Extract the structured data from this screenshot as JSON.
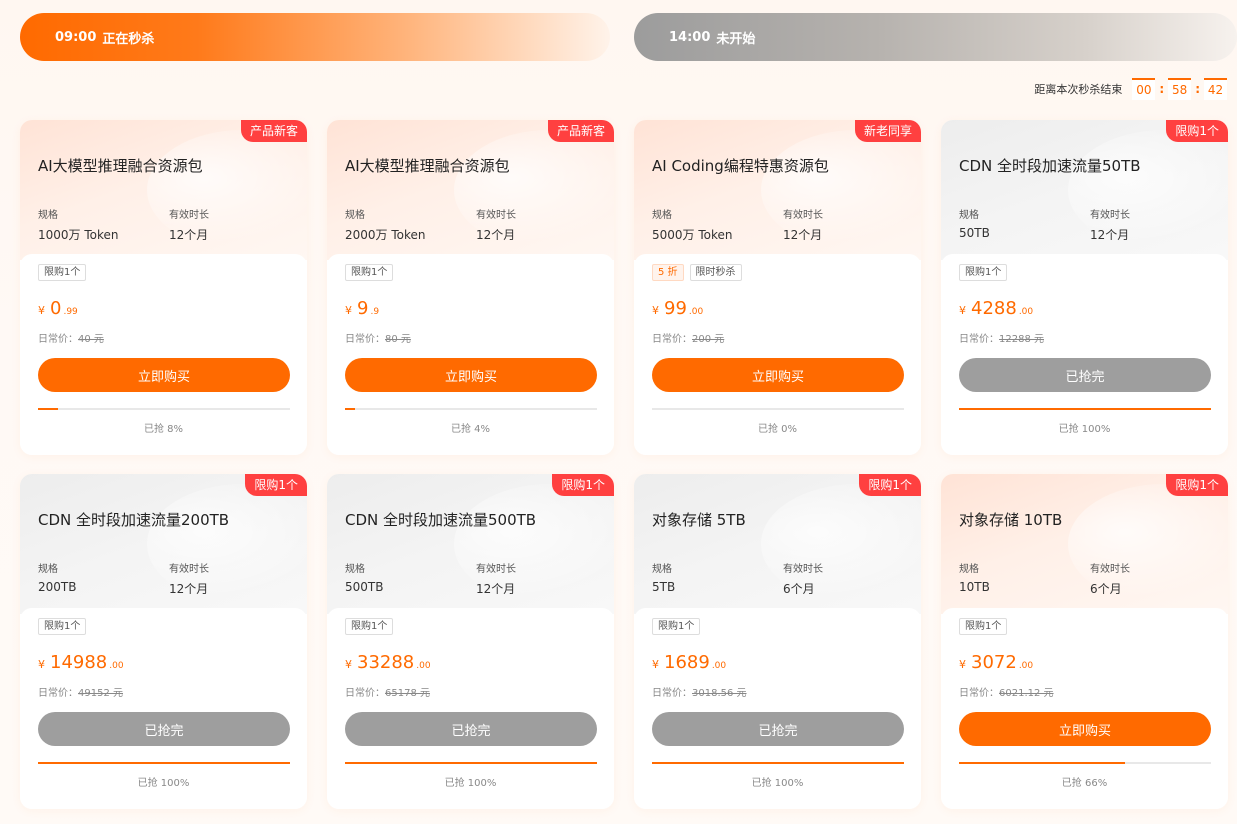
{
  "sessions": [
    {
      "time": "09:00",
      "status": "正在秒杀"
    },
    {
      "time": "14:00",
      "status": "未开始"
    }
  ],
  "countdown": {
    "label": "距离本次秒杀结束",
    "hours": "00",
    "minutes": "58",
    "seconds": "42"
  },
  "spec_label": "规格",
  "duration_label": "有效时长",
  "orig_label": "日常价：",
  "products": [
    {
      "badge": "产品新客",
      "badge_theme": "warm",
      "title": "AI大模型推理融合资源包",
      "spec": "1000万 Token",
      "duration": "12个月",
      "tags": [
        {
          "text": "限购1个",
          "type": "normal"
        }
      ],
      "price_int": "0",
      "price_dec": ".99",
      "orig_price": "40 元",
      "button": "立即购买",
      "button_state": "buy",
      "progress_pct": 8,
      "progress_text": "已抢 8%"
    },
    {
      "badge": "产品新客",
      "badge_theme": "warm",
      "title": "AI大模型推理融合资源包",
      "spec": "2000万 Token",
      "duration": "12个月",
      "tags": [
        {
          "text": "限购1个",
          "type": "normal"
        }
      ],
      "price_int": "9",
      "price_dec": ".9",
      "orig_price": "80 元",
      "button": "立即购买",
      "button_state": "buy",
      "progress_pct": 4,
      "progress_text": "已抢 4%"
    },
    {
      "badge": "新老同享",
      "badge_theme": "warm",
      "title": "AI Coding编程特惠资源包",
      "spec": "5000万 Token",
      "duration": "12个月",
      "tags": [
        {
          "text": "5 折",
          "type": "disc"
        },
        {
          "text": "限时秒杀",
          "type": "normal"
        }
      ],
      "price_int": "99",
      "price_dec": ".00",
      "orig_price": "200 元",
      "button": "立即购买",
      "button_state": "buy",
      "progress_pct": 0,
      "progress_text": "已抢 0%"
    },
    {
      "badge": "限购1个",
      "badge_theme": "gray",
      "title": "CDN 全时段加速流量50TB",
      "spec": "50TB",
      "duration": "12个月",
      "tags": [
        {
          "text": "限购1个",
          "type": "normal"
        }
      ],
      "price_int": "4288",
      "price_dec": ".00",
      "orig_price": "12288 元",
      "button": "已抢完",
      "button_state": "out",
      "progress_pct": 100,
      "progress_text": "已抢 100%"
    },
    {
      "badge": "限购1个",
      "badge_theme": "gray",
      "title": "CDN 全时段加速流量200TB",
      "spec": "200TB",
      "duration": "12个月",
      "tags": [
        {
          "text": "限购1个",
          "type": "normal"
        }
      ],
      "price_int": "14988",
      "price_dec": ".00",
      "orig_price": "49152 元",
      "button": "已抢完",
      "button_state": "out",
      "progress_pct": 100,
      "progress_text": "已抢 100%"
    },
    {
      "badge": "限购1个",
      "badge_theme": "gray",
      "title": "CDN 全时段加速流量500TB",
      "spec": "500TB",
      "duration": "12个月",
      "tags": [
        {
          "text": "限购1个",
          "type": "normal"
        }
      ],
      "price_int": "33288",
      "price_dec": ".00",
      "orig_price": "65178 元",
      "button": "已抢完",
      "button_state": "out",
      "progress_pct": 100,
      "progress_text": "已抢 100%"
    },
    {
      "badge": "限购1个",
      "badge_theme": "gray",
      "title": "对象存储 5TB",
      "spec": "5TB",
      "duration": "6个月",
      "tags": [
        {
          "text": "限购1个",
          "type": "normal"
        }
      ],
      "price_int": "1689",
      "price_dec": ".00",
      "orig_price": "3018.56 元",
      "button": "已抢完",
      "button_state": "out",
      "progress_pct": 100,
      "progress_text": "已抢 100%"
    },
    {
      "badge": "限购1个",
      "badge_theme": "warm",
      "title": "对象存储 10TB",
      "spec": "10TB",
      "duration": "6个月",
      "tags": [
        {
          "text": "限购1个",
          "type": "normal"
        }
      ],
      "price_int": "3072",
      "price_dec": ".00",
      "orig_price": "6021.12 元",
      "button": "立即购买",
      "button_state": "buy",
      "progress_pct": 66,
      "progress_text": "已抢 66%"
    }
  ],
  "colors": {
    "accent": "#ff6a00",
    "badge_red": "#ff4040",
    "sold_out": "#9e9e9e"
  }
}
